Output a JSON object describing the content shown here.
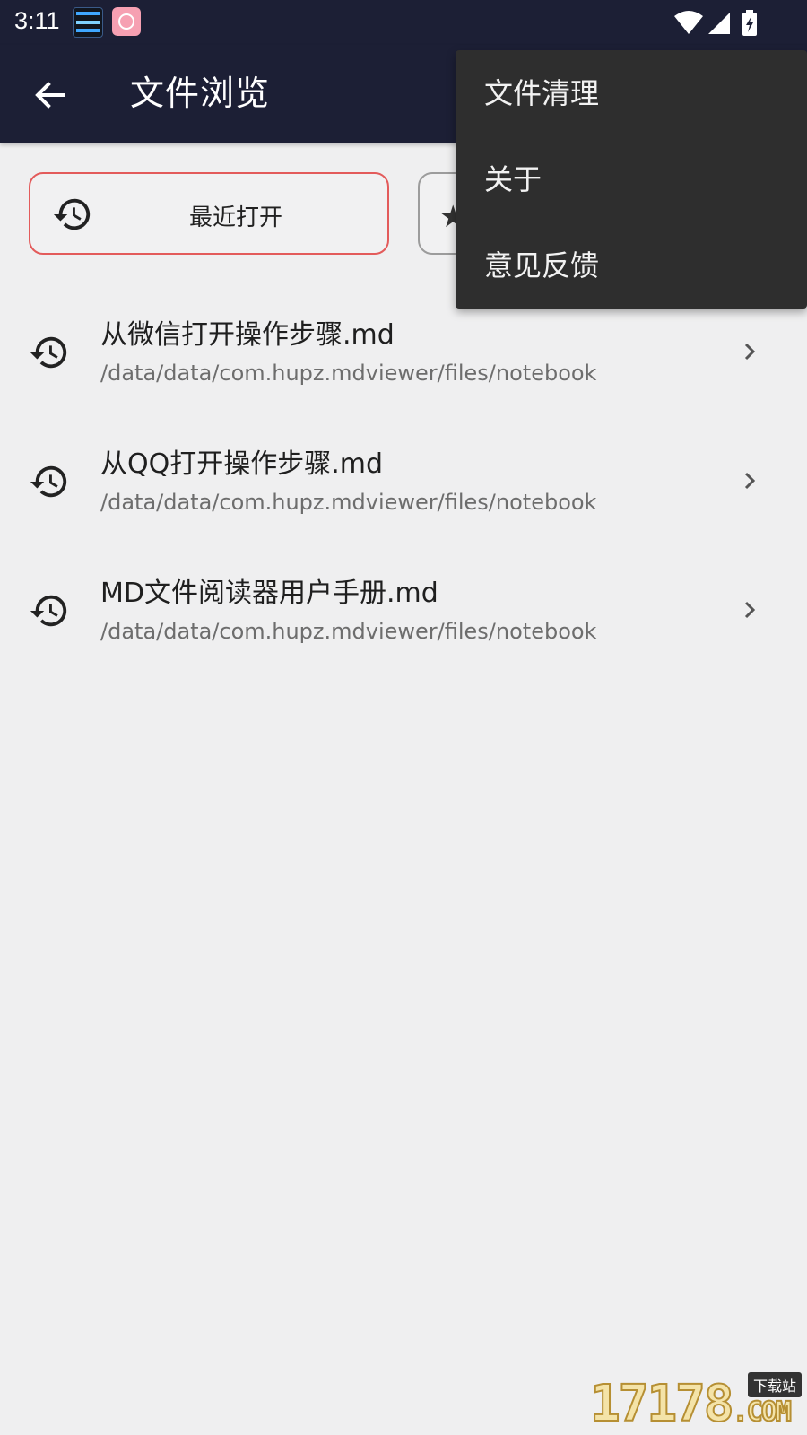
{
  "status_bar": {
    "time": "3:11"
  },
  "app_bar": {
    "title": "文件浏览"
  },
  "tabs": {
    "recent_label": "最近打开"
  },
  "files": [
    {
      "title": "从微信打开操作步骤.md",
      "path": "/data/data/com.hupz.mdviewer/files/notebook"
    },
    {
      "title": "从QQ打开操作步骤.md",
      "path": "/data/data/com.hupz.mdviewer/files/notebook"
    },
    {
      "title": "MD文件阅读器用户手册.md",
      "path": "/data/data/com.hupz.mdviewer/files/notebook"
    }
  ],
  "menu": {
    "items": [
      {
        "label": "文件清理"
      },
      {
        "label": "关于"
      },
      {
        "label": "意见反馈"
      }
    ]
  },
  "watermark": {
    "text": "17178",
    "suffix": ".COM",
    "badge": "下载站"
  },
  "colors": {
    "appbar": "#1c1f35",
    "active_tab_border": "#e35b5b",
    "menu_bg": "#2e2e2e"
  }
}
